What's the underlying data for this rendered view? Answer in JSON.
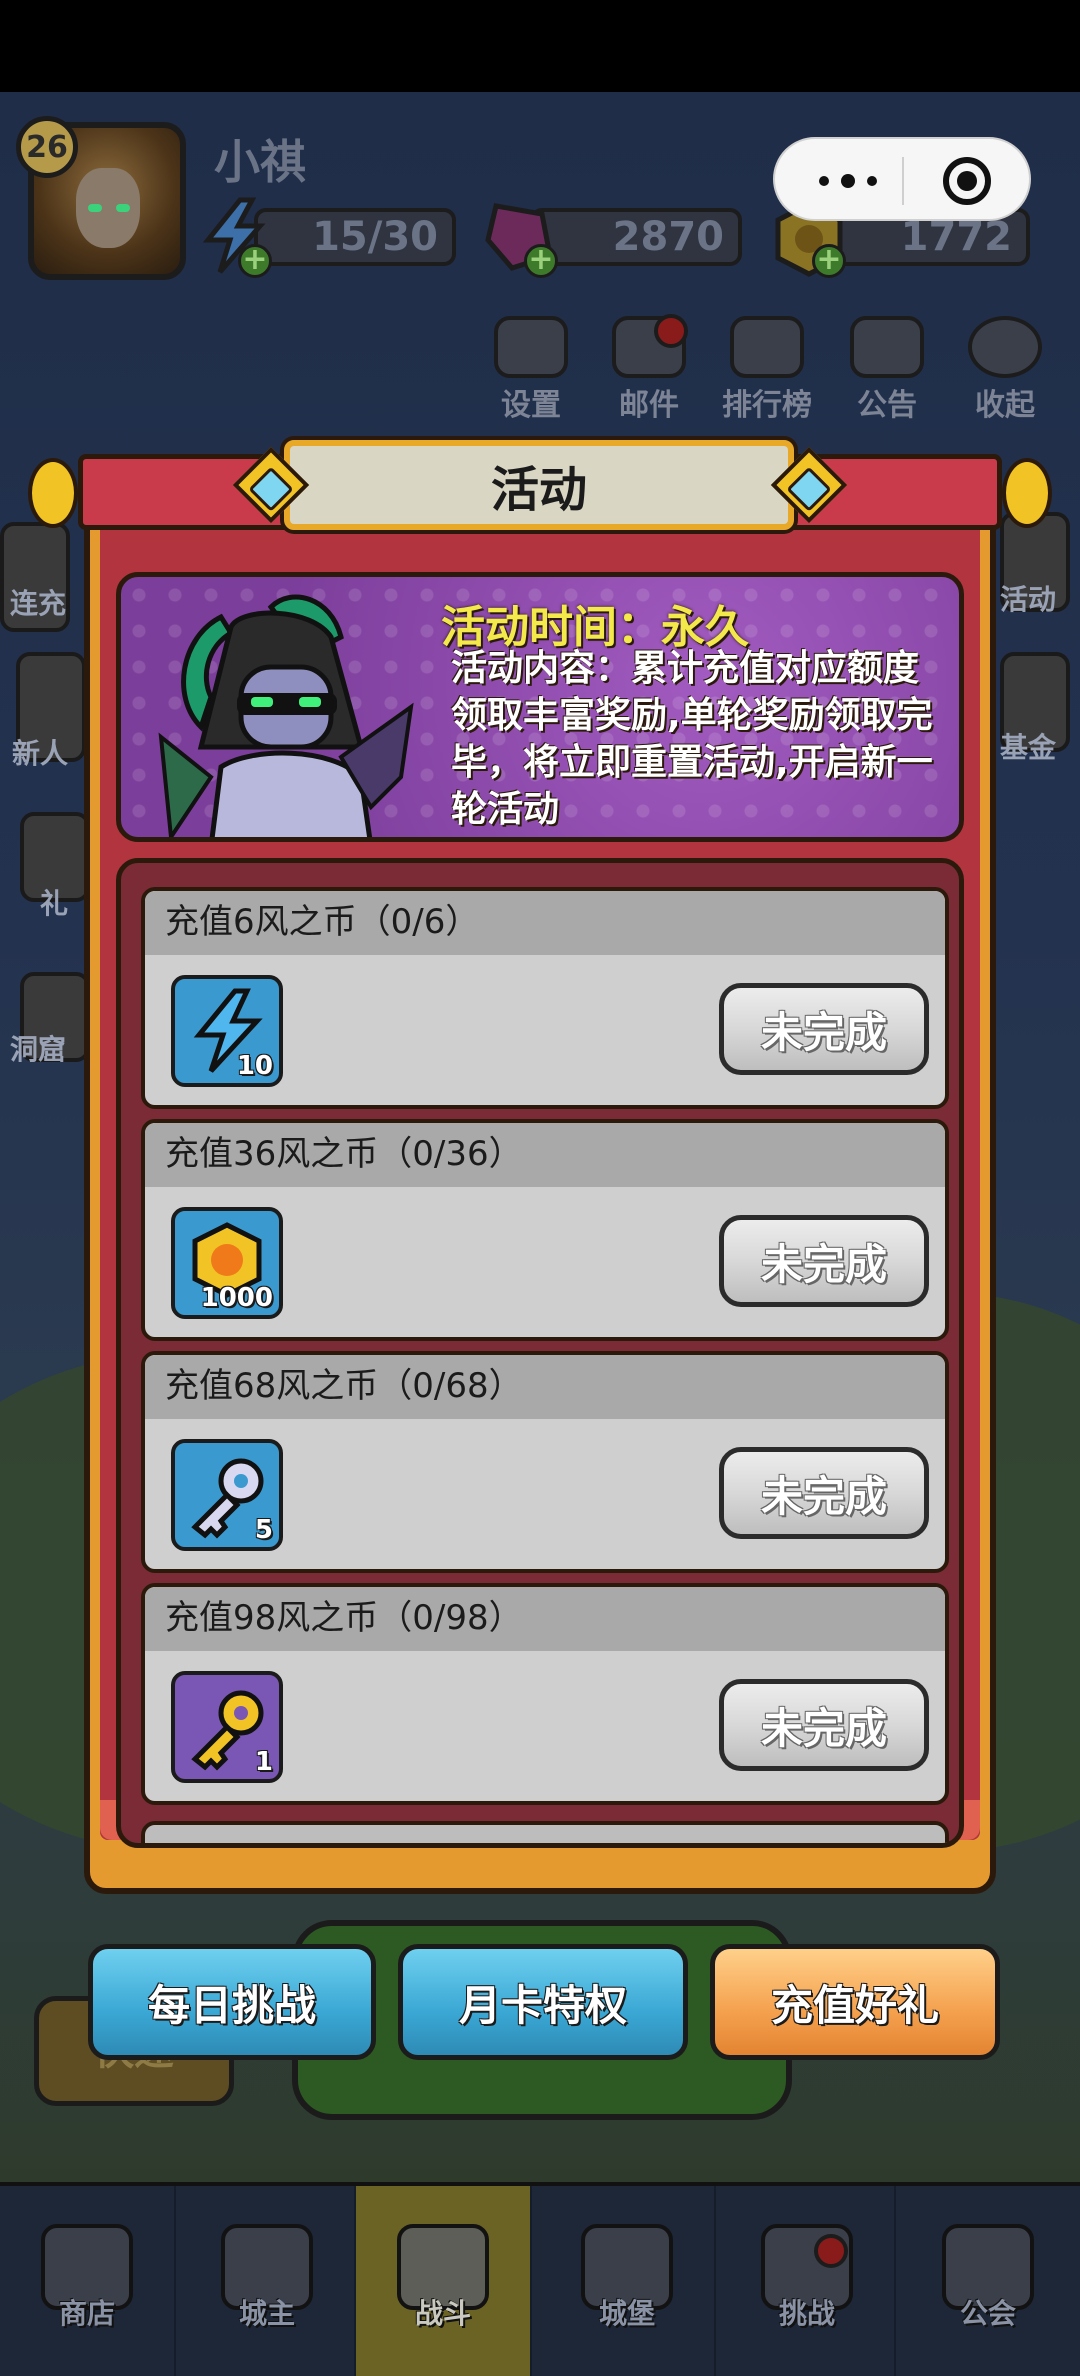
{
  "player": {
    "level": "26",
    "name": "小祺",
    "energy": "15/30",
    "gems": "2870",
    "gold": "1772"
  },
  "top_menu": [
    {
      "label": "设置",
      "icon": "gear-icon"
    },
    {
      "label": "邮件",
      "icon": "mail-icon"
    },
    {
      "label": "排行榜",
      "icon": "leaderboard-icon"
    },
    {
      "label": "公告",
      "icon": "megaphone-icon"
    },
    {
      "label": "收起",
      "icon": "collapse-icon"
    }
  ],
  "background_labels": [
    "连充",
    "新人",
    "礼",
    "洞窟",
    "活动",
    "基金",
    "快速"
  ],
  "modal": {
    "title": "活动",
    "banner": {
      "time_label": "活动时间：永久",
      "description": "活动内容：累计充值对应额度领取丰富奖励,单轮奖励领取完毕，将立即重置活动,开启新一轮活动"
    },
    "tasks": [
      {
        "title": "充值6风之币（0/6）",
        "reward_icon": "energy-bolt-icon",
        "reward_count": "10",
        "status": "未完成"
      },
      {
        "title": "充值36风之币（0/36）",
        "reward_icon": "gold-coin-icon",
        "reward_count": "1000",
        "status": "未完成"
      },
      {
        "title": "充值68风之币（0/68）",
        "reward_icon": "silver-key-icon",
        "reward_count": "5",
        "status": "未完成"
      },
      {
        "title": "充值98风之币（0/98）",
        "reward_icon": "gold-key-icon",
        "reward_count": "1",
        "status": "未完成"
      }
    ]
  },
  "tabs": [
    {
      "label": "每日挑战",
      "active": false
    },
    {
      "label": "月卡特权",
      "active": false
    },
    {
      "label": "充值好礼",
      "active": true
    }
  ],
  "bottom_nav": [
    {
      "label": "商店",
      "icon": "shop-icon"
    },
    {
      "label": "城主",
      "icon": "crown-icon"
    },
    {
      "label": "战斗",
      "icon": "crossed-swords-icon",
      "active": true
    },
    {
      "label": "城堡",
      "icon": "castle-icon"
    },
    {
      "label": "挑战",
      "icon": "demon-icon"
    },
    {
      "label": "公会",
      "icon": "guild-banner-icon"
    }
  ],
  "colors": {
    "modal_frame": "#e59a2f",
    "modal_inner": "#b2343f",
    "title_plate": "#d9d6c4",
    "banner_purple": "#7c3e9b",
    "banner_title_yellow": "#f3e94a",
    "tab_blue": "#3aa7d4",
    "tab_orange": "#f4a04d"
  }
}
